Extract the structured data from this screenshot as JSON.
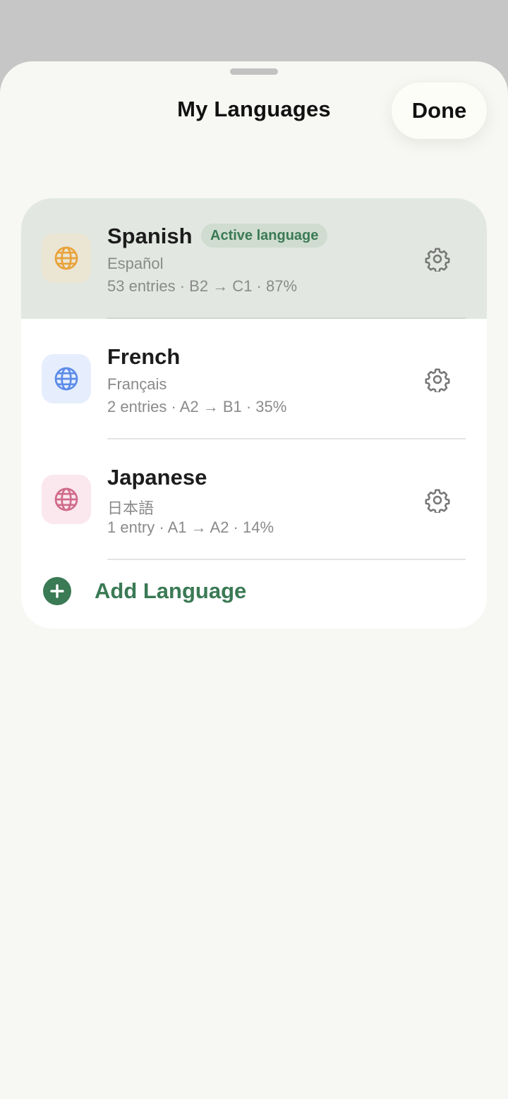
{
  "header": {
    "title": "My Languages",
    "done_label": "Done"
  },
  "languages": [
    {
      "name": "Spanish",
      "badge": "Active language",
      "native": "Español",
      "meta": "53 entries · B2 → C1 · 87%",
      "active": true,
      "icon": "globe-icon",
      "icon_color": "#e8a23a",
      "icon_bg": "#ebe5d3"
    },
    {
      "name": "French",
      "native": "Français",
      "meta": "2 entries · A2 → B1 · 35%",
      "active": false,
      "icon": "globe-icon",
      "icon_color": "#5b8be8",
      "icon_bg": "#e6eefd"
    },
    {
      "name": "Japanese",
      "native": "日本語",
      "meta": "1 entry · A1 → A2 · 14%",
      "active": false,
      "icon": "globe-icon",
      "icon_color": "#cf6a8a",
      "icon_bg": "#fbe7ee"
    }
  ],
  "add_language": {
    "label": "Add Language",
    "icon": "plus-circle-icon"
  },
  "colors": {
    "accent": "#3a7a54",
    "active_row_bg": "#e2e8e1",
    "sheet_bg": "#f7f7f3",
    "backdrop": "#c6c6c6"
  }
}
